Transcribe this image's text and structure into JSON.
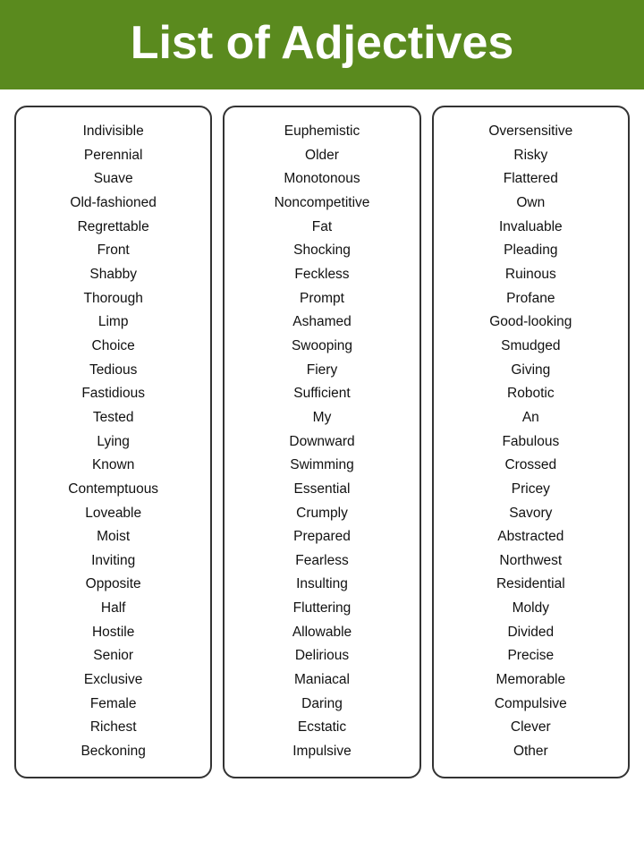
{
  "header": {
    "title": "List of Adjectives",
    "bg_color": "#5a8a1e"
  },
  "columns": [
    {
      "id": "col1",
      "words": [
        "Indivisible",
        "Perennial",
        "Suave",
        "Old-fashioned",
        "Regrettable",
        "Front",
        "Shabby",
        "Thorough",
        "Limp",
        "Choice",
        "Tedious",
        "Fastidious",
        "Tested",
        "Lying",
        "Known",
        "Contemptuous",
        "Loveable",
        "Moist",
        "Inviting",
        "Opposite",
        "Half",
        "Hostile",
        "Senior",
        "Exclusive",
        "Female",
        "Richest",
        "Beckoning"
      ]
    },
    {
      "id": "col2",
      "words": [
        "Euphemistic",
        "Older",
        "Monotonous",
        "Noncompetitive",
        "Fat",
        "Shocking",
        "Feckless",
        "Prompt",
        "Ashamed",
        "Swooping",
        "Fiery",
        "Sufficient",
        "My",
        "Downward",
        "Swimming",
        "Essential",
        "Crumply",
        "Prepared",
        "Fearless",
        "Insulting",
        "Fluttering",
        "Allowable",
        "Delirious",
        "Maniacal",
        "Daring",
        "Ecstatic",
        "Impulsive"
      ]
    },
    {
      "id": "col3",
      "words": [
        "Oversensitive",
        "Risky",
        "Flattered",
        "Own",
        "Invaluable",
        "Pleading",
        "Ruinous",
        "Profane",
        "Good-looking",
        "Smudged",
        "Giving",
        "Robotic",
        "An",
        "Fabulous",
        "Crossed",
        "Pricey",
        "Savory",
        "Abstracted",
        "Northwest",
        "Residential",
        "Moldy",
        "Divided",
        "Precise",
        "Memorable",
        "Compulsive",
        "Clever",
        "Other"
      ]
    }
  ]
}
